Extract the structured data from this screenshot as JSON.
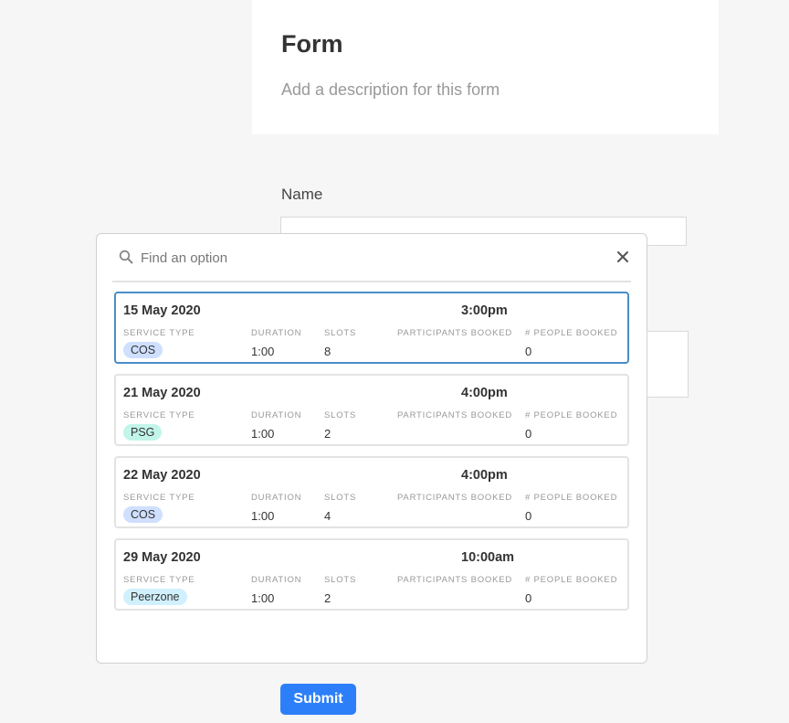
{
  "form": {
    "title": "Form",
    "description": "Add a description for this form",
    "name_label": "Name",
    "submit_label": "Submit"
  },
  "dropdown": {
    "search_placeholder": "Find an option",
    "column_labels": {
      "service_type": "SERVICE TYPE",
      "duration": "DURATION",
      "slots": "SLOTS",
      "participants_booked": "PARTICIPANTS BOOKED",
      "people_booked": "# PEOPLE BOOKED"
    },
    "options": [
      {
        "date": "15 May 2020",
        "time": "3:00pm",
        "service_type": "COS",
        "tag_color": "#cfdfff",
        "duration": "1:00",
        "slots": "8",
        "participants_booked": "",
        "people_booked": "0",
        "selected": true
      },
      {
        "date": "21 May 2020",
        "time": "4:00pm",
        "service_type": "PSG",
        "tag_color": "#c2f5e9",
        "duration": "1:00",
        "slots": "2",
        "participants_booked": "",
        "people_booked": "0",
        "selected": false
      },
      {
        "date": "22 May 2020",
        "time": "4:00pm",
        "service_type": "COS",
        "tag_color": "#cfdfff",
        "duration": "1:00",
        "slots": "4",
        "participants_booked": "",
        "people_booked": "0",
        "selected": false
      },
      {
        "date": "29 May 2020",
        "time": "10:00am",
        "service_type": "Peerzone",
        "tag_color": "#d0f0fd",
        "duration": "1:00",
        "slots": "2",
        "participants_booked": "",
        "people_booked": "0",
        "selected": false
      }
    ]
  },
  "icons": {
    "search": "search-icon",
    "close": "close-icon"
  },
  "colors": {
    "accent": "#2d7ff9",
    "selected_border": "#4a8ec9"
  }
}
